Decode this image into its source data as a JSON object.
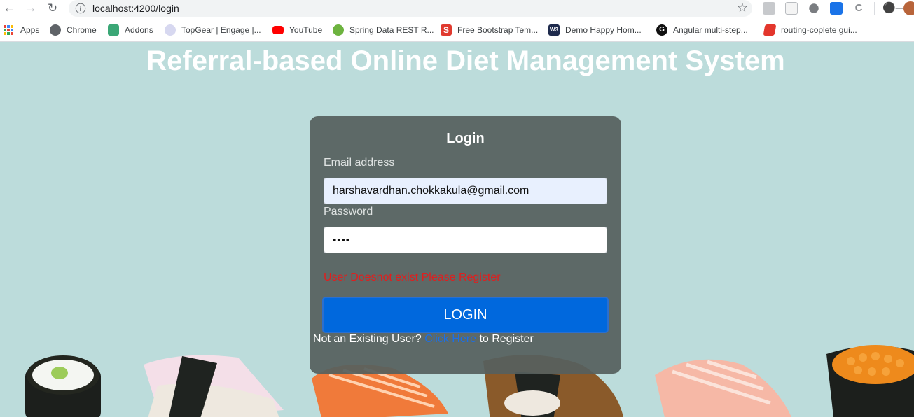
{
  "browser": {
    "url": "localhost:4200/login",
    "bookmarks": [
      {
        "label": "Apps",
        "icon": "apps-grid-icon"
      },
      {
        "label": "Chrome",
        "icon": "chrome-icon"
      },
      {
        "label": "Addons",
        "icon": "puzzle-icon"
      },
      {
        "label": "TopGear | Engage |...",
        "icon": "topgear-icon"
      },
      {
        "label": "YouTube",
        "icon": "youtube-icon"
      },
      {
        "label": "Spring Data REST R...",
        "icon": "spring-icon"
      },
      {
        "label": "Free Bootstrap Tem...",
        "icon": "s-icon"
      },
      {
        "label": "Demo Happy Hom...",
        "icon": "w3-icon"
      },
      {
        "label": "Angular multi-step...",
        "icon": "g-icon"
      },
      {
        "label": "routing-coplete gui...",
        "icon": "routing-icon"
      }
    ]
  },
  "page": {
    "title": "Referral-based Online Diet Management System"
  },
  "login": {
    "heading": "Login",
    "email_label": "Email address",
    "email_value": "harshavardhan.chokkakula@gmail.com",
    "password_label": "Password",
    "password_value": "••••",
    "error_message": "User Doesnot exist Please Register",
    "login_button": "LOGIN",
    "register_prefix": "Not an Existing User?",
    "register_link": "Click Here",
    "register_suffix": "to Register"
  },
  "colors": {
    "page_background": "#bcdcdb",
    "card_background": "#56605e",
    "login_button": "#0068dd",
    "error_text": "#e01e1e",
    "link_text": "#1a6fe8"
  }
}
